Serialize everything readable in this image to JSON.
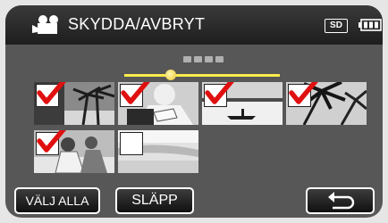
{
  "header": {
    "title": "SKYDDA/AVBRYT",
    "mode_icon": "video-camera-icon",
    "storage_badge": "SD",
    "battery_icon": "battery-icon"
  },
  "pager": {
    "page_dots": 4,
    "slider_position": 0.3
  },
  "thumbnails": [
    {
      "scene": "palm-trees",
      "checked": true
    },
    {
      "scene": "person-reading",
      "checked": true
    },
    {
      "scene": "boat-on-lake",
      "checked": true
    },
    {
      "scene": "palm-leaves",
      "checked": true
    },
    {
      "scene": "people-at-beach",
      "checked": true
    },
    {
      "scene": "beach-shore",
      "checked": false
    }
  ],
  "buttons": {
    "select_all": "VÄLJ ALLA",
    "release": "SLÄPP",
    "back_icon": "return-arrow-icon"
  },
  "colors": {
    "panel": "#575757",
    "header": "#1e1e1e",
    "checkmark": "#e01010",
    "slider": "#ffec4a"
  }
}
